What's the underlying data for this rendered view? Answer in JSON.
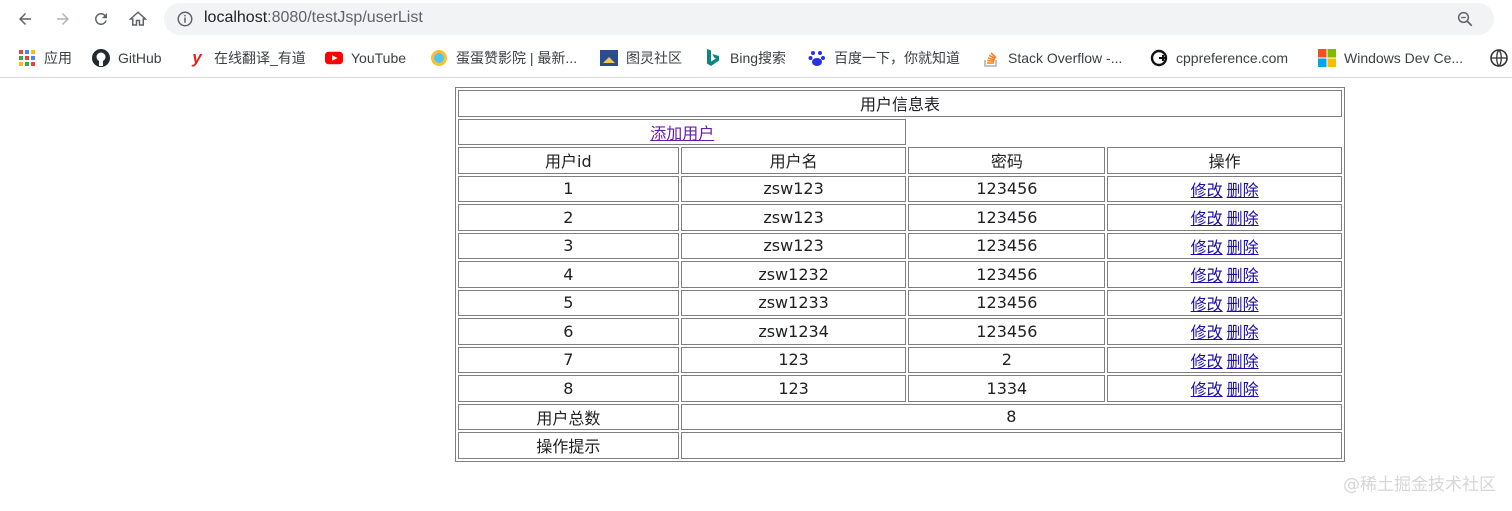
{
  "browser": {
    "url_host": "localhost",
    "url_path": ":8080/testJsp/userList"
  },
  "bookmarks": [
    {
      "label": "应用",
      "icon": "apps-grid-icon"
    },
    {
      "label": "GitHub",
      "icon": "github-icon"
    },
    {
      "label": "在线翻译_有道",
      "icon": "youdao-icon"
    },
    {
      "label": "YouTube",
      "icon": "youtube-icon"
    },
    {
      "label": "蛋蛋赞影院 | 最新...",
      "icon": "site-icon"
    },
    {
      "label": "图灵社区",
      "icon": "turing-icon"
    },
    {
      "label": "Bing搜索",
      "icon": "bing-icon"
    },
    {
      "label": "百度一下，你就知道",
      "icon": "baidu-icon"
    },
    {
      "label": "Stack Overflow -...",
      "icon": "stackoverflow-icon"
    },
    {
      "label": "cppreference.com",
      "icon": "cppreference-icon"
    },
    {
      "label": "Windows Dev Ce...",
      "icon": "windows-icon"
    }
  ],
  "table": {
    "title": "用户信息表",
    "add_user": "添加用户",
    "headers": [
      "用户id",
      "用户名",
      "密码",
      "操作"
    ],
    "rows": [
      {
        "id": "1",
        "name": "zsw123",
        "password": "123456"
      },
      {
        "id": "2",
        "name": "zsw123",
        "password": "123456"
      },
      {
        "id": "3",
        "name": "zsw123",
        "password": "123456"
      },
      {
        "id": "4",
        "name": "zsw1232",
        "password": "123456"
      },
      {
        "id": "5",
        "name": "zsw1233",
        "password": "123456"
      },
      {
        "id": "6",
        "name": "zsw1234",
        "password": "123456"
      },
      {
        "id": "7",
        "name": "123",
        "password": "2"
      },
      {
        "id": "8",
        "name": "123",
        "password": "1334"
      }
    ],
    "edit_label": "修改",
    "delete_label": "删除",
    "total_label": "用户总数",
    "total_value": "8",
    "hint_label": "操作提示",
    "hint_value": ""
  },
  "watermark": "@稀土掘金技术社区"
}
